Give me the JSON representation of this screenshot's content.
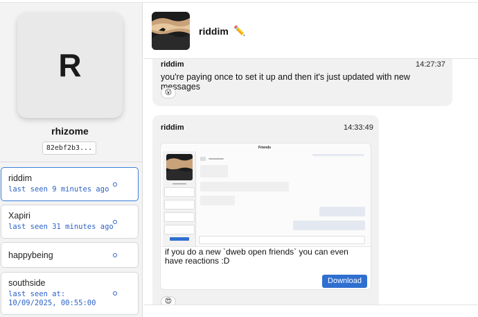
{
  "profile": {
    "initial": "R",
    "name": "rhizome",
    "key": "82ebf2b3..."
  },
  "contacts": [
    {
      "name": "riddim",
      "last_seen": "last seen 9 minutes ago",
      "active": true
    },
    {
      "name": "Xapiri",
      "last_seen": "last seen 31 minutes ago",
      "active": false
    },
    {
      "name": "happybeing",
      "last_seen": "",
      "active": false
    },
    {
      "name": "southside",
      "last_seen": "last seen at: 10/09/2025, 00:55:00",
      "active": false
    }
  ],
  "chat": {
    "name": "riddim",
    "edit_icon": "pencil-icon"
  },
  "messages": [
    {
      "sender": "riddim",
      "time": "14:27:37",
      "text": "you're paying once to set it up and then it's just updated with new messages",
      "reaction": "😮"
    },
    {
      "sender": "riddim",
      "time": "14:33:49",
      "attachment_caption": "if you do a new `dweb open friends` you can even have reactions :D",
      "download_label": "Download",
      "reaction": "😍"
    }
  ],
  "attachment_screenshot": {
    "window_title": "Friends"
  },
  "colors": {
    "accent": "#2f6fd0",
    "link": "#2b62c7",
    "sidebar_bg": "#f3f3f3",
    "bubble_bg": "#f1f1f1"
  }
}
